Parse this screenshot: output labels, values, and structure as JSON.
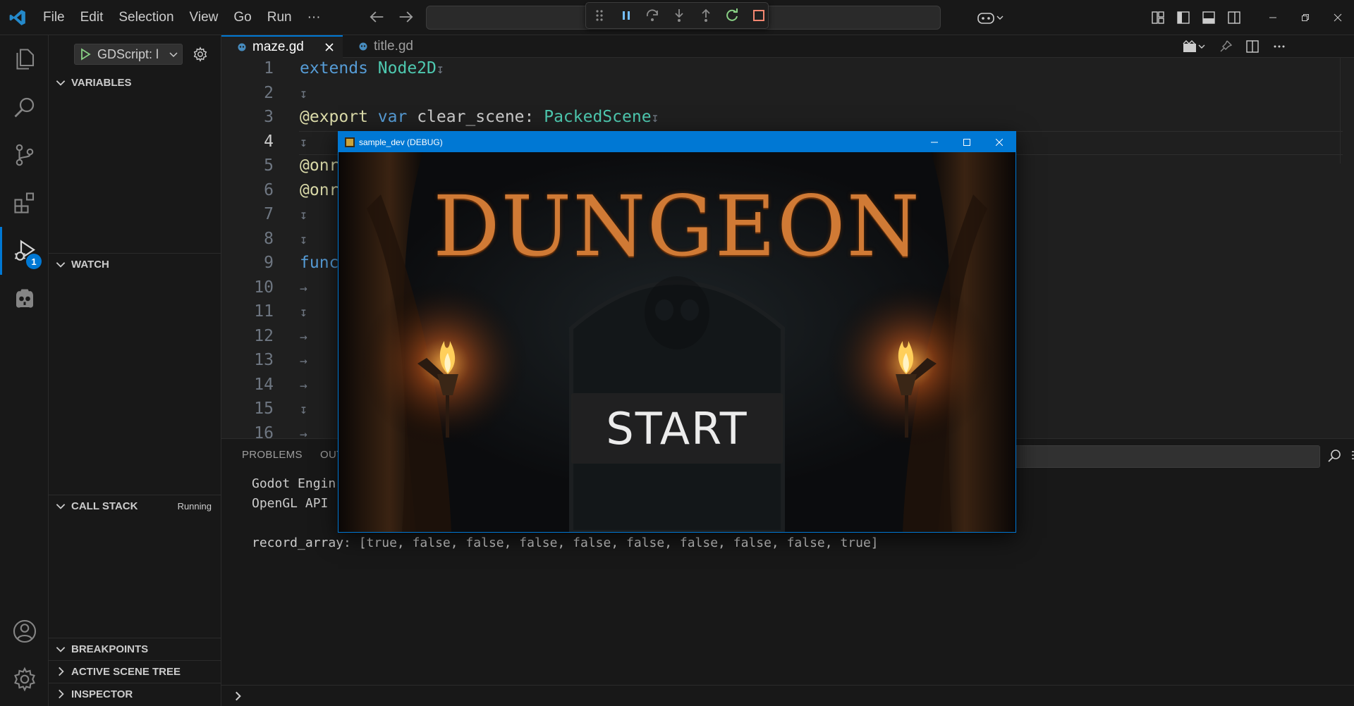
{
  "menu": [
    "File",
    "Edit",
    "Selection",
    "View",
    "Go",
    "Run",
    "···"
  ],
  "debug_toolbar": {
    "buttons": [
      "drag-handle",
      "pause",
      "step-over",
      "step-into",
      "step-out",
      "restart",
      "stop"
    ]
  },
  "sidebar": {
    "launch_config": "GDScript: l",
    "sections": {
      "variables": "VARIABLES",
      "watch": "WATCH",
      "call_stack": "CALL STACK",
      "call_stack_status": "Running",
      "breakpoints": "BREAKPOINTS",
      "active_scene_tree": "ACTIVE SCENE TREE",
      "inspector": "INSPECTOR"
    }
  },
  "activity": {
    "run_debug_badge": "1"
  },
  "tabs": [
    {
      "label": "maze.gd",
      "active": true
    },
    {
      "label": "title.gd",
      "active": false
    }
  ],
  "editor": {
    "current_line": 4,
    "lines": [
      {
        "n": "1",
        "parts": [
          [
            "kw",
            "extends"
          ],
          [
            "",
            " "
          ],
          [
            "ty",
            "Node2D"
          ],
          [
            "ws",
            "↧"
          ]
        ]
      },
      {
        "n": "2",
        "parts": [
          [
            "ws",
            "↧"
          ]
        ]
      },
      {
        "n": "3",
        "parts": [
          [
            "an",
            "@export"
          ],
          [
            "",
            " "
          ],
          [
            "kw",
            "var"
          ],
          [
            "",
            " clear_scene: "
          ],
          [
            "ty",
            "PackedScene"
          ],
          [
            "ws",
            "↧"
          ]
        ]
      },
      {
        "n": "4",
        "parts": [
          [
            "ws",
            "↧"
          ]
        ]
      },
      {
        "n": "5",
        "parts": [
          [
            "an",
            "@onre"
          ]
        ]
      },
      {
        "n": "6",
        "parts": [
          [
            "an",
            "@onre"
          ]
        ]
      },
      {
        "n": "7",
        "parts": [
          [
            "ws",
            "↧"
          ]
        ]
      },
      {
        "n": "8",
        "parts": [
          [
            "ws",
            "↧"
          ]
        ]
      },
      {
        "n": "9",
        "parts": [
          [
            "kw",
            "func"
          ]
        ]
      },
      {
        "n": "10",
        "parts": [
          [
            "ws",
            "→"
          ]
        ]
      },
      {
        "n": "11",
        "parts": [
          [
            "ws",
            "↧"
          ]
        ]
      },
      {
        "n": "12",
        "parts": [
          [
            "ws",
            "→"
          ]
        ]
      },
      {
        "n": "13",
        "parts": [
          [
            "ws",
            "→"
          ]
        ]
      },
      {
        "n": "14",
        "parts": [
          [
            "ws",
            "→"
          ]
        ]
      },
      {
        "n": "15",
        "parts": [
          [
            "ws",
            "↧"
          ]
        ]
      },
      {
        "n": "16",
        "parts": [
          [
            "ws",
            "→"
          ]
        ]
      }
    ]
  },
  "panel": {
    "tabs": [
      "PROBLEMS",
      "OUT"
    ],
    "output": [
      "Godot Engin",
      "OpenGL API",
      "",
      "record_array: [true, false, false, false, false, false, false, false, false, true]"
    ]
  },
  "game_window": {
    "title": "sample_dev (DEBUG)",
    "heading": "DUNGEON",
    "start_label": "START"
  }
}
